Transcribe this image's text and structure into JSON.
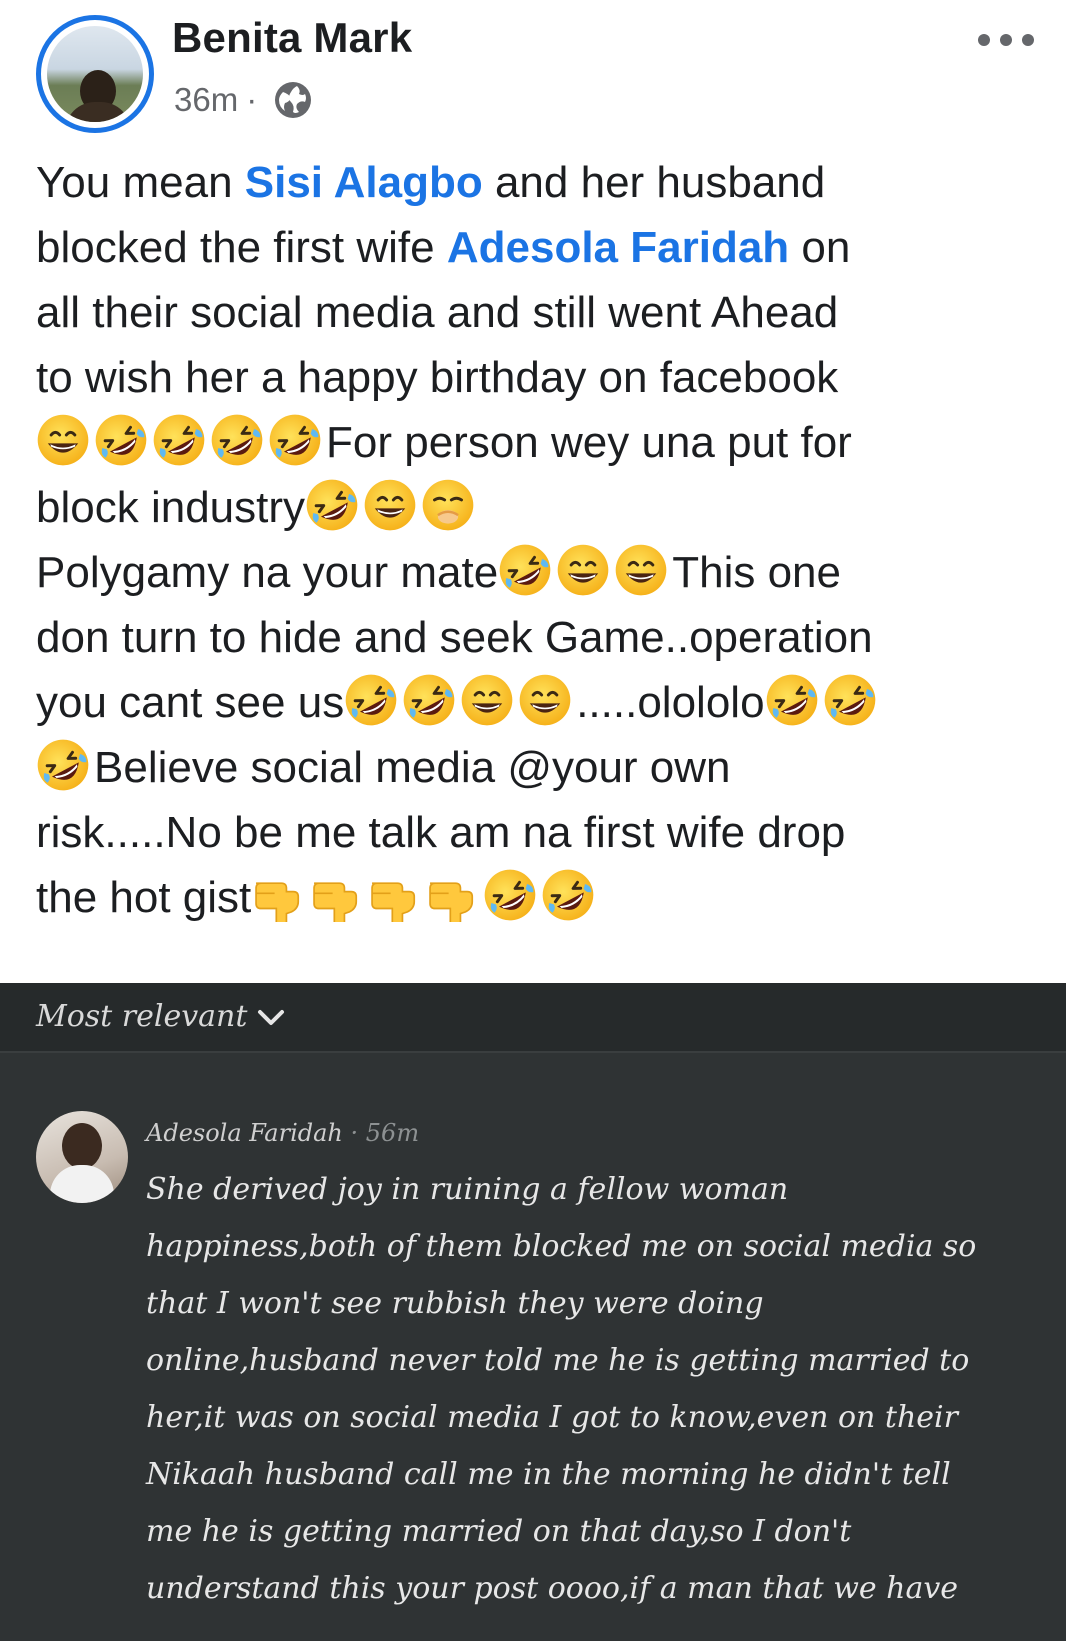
{
  "post": {
    "author": "Benita Mark",
    "time": "36m",
    "meta_separator": "·",
    "privacy_icon": "globe-icon",
    "more_icon": "more-options-icon",
    "mentions": {
      "first": "Sisi Alagbo",
      "second": "Adesola Faridah"
    },
    "text": {
      "l1_a": "You mean ",
      "l1_b": " and her husband",
      "l2_a": "blocked the first  wife  ",
      "l2_b": " on",
      "l3": "all their social media and still went Ahead",
      "l4": "to wish her a happy birthday on facebook",
      "l5": "For person wey una put for",
      "l6": "block industry",
      "l7_a": "Polygamy na your mate",
      "l7_b": "This one",
      "l8": "don turn to hide and seek Game..operation",
      "l9_a": "you cant see us",
      "l9_b": ".....olololo",
      "l10": "Believe social media @your own",
      "l11": "risk.....No be me talk am na first wife drop",
      "l12": "the hot gist"
    },
    "emoji_names": [
      "grinning-face-icon",
      "rolling-on-floor-laughing-icon",
      "hand-over-mouth-laughing-icon",
      "backhand-index-pointing-down-icon"
    ]
  },
  "screenshot": {
    "sort_label": "Most relevant",
    "sort_icon": "chevron-down-icon",
    "comment": {
      "author": "Adesola Faridah",
      "separator": " · ",
      "time": "56m",
      "lines": [
        "She derived joy in ruining a fellow woman",
        "happiness,both of them blocked me on social media so",
        "that I won't see rubbish they were doing",
        "online,husband never told me he is getting married to",
        "her,it was on social media I got to know,even on their",
        "Nikaah husband call me in the morning he didn't tell",
        "me he is getting married on that day,so I don't",
        "understand this your post oooo,if a man that we have"
      ]
    }
  },
  "colors": {
    "accent": "#1b74e4",
    "text": "#1c1e21",
    "meta": "#65676b",
    "panel": "#2f3334"
  }
}
